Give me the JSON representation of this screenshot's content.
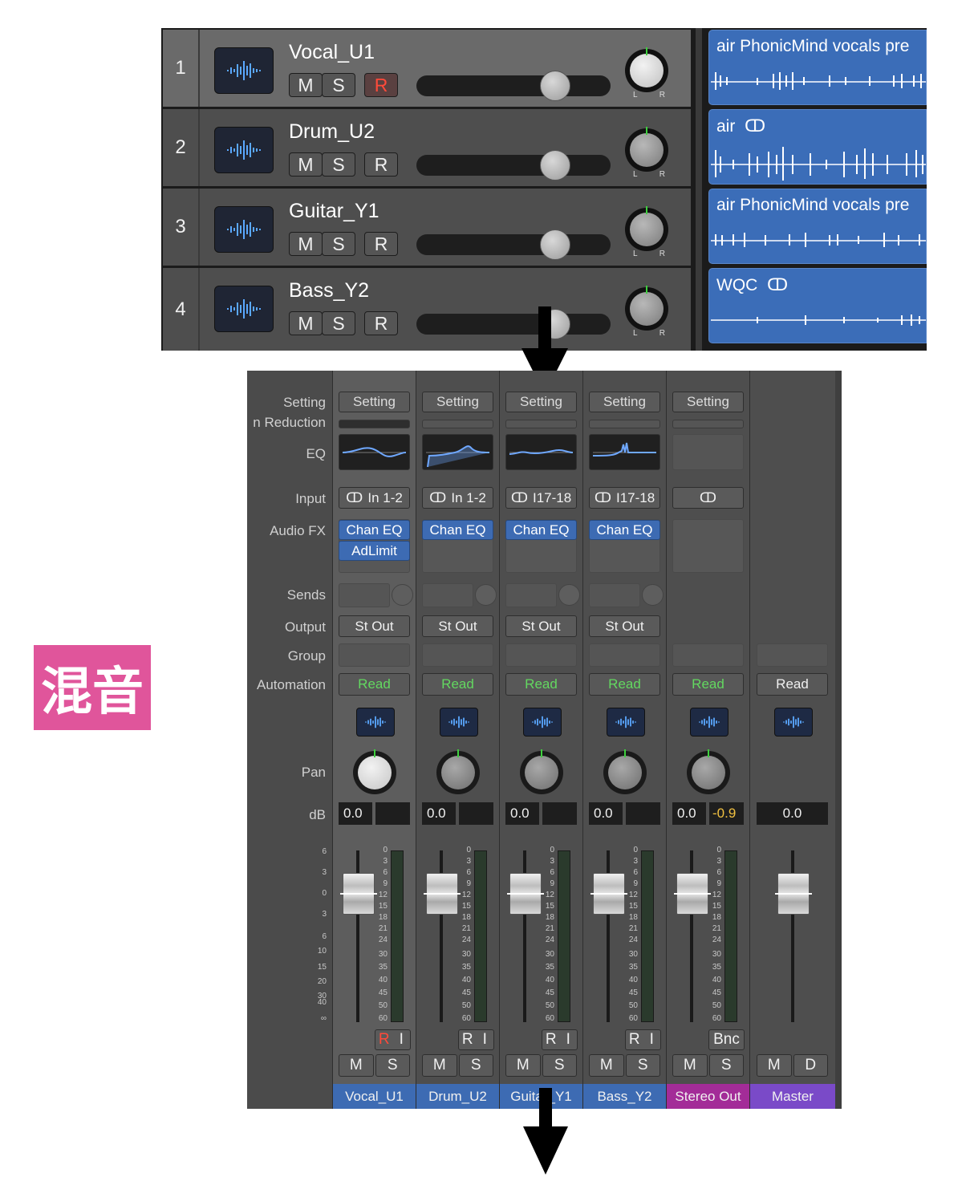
{
  "tracks": [
    {
      "number": "1",
      "name": "Vocal_U1",
      "mute": "M",
      "solo": "S",
      "record": "R",
      "record_armed": true,
      "region_name": "air PhonicMind vocals pre",
      "region_linked": false
    },
    {
      "number": "2",
      "name": "Drum_U2",
      "mute": "M",
      "solo": "S",
      "record": "R",
      "record_armed": false,
      "region_name": "air",
      "region_linked": true
    },
    {
      "number": "3",
      "name": "Guitar_Y1",
      "mute": "M",
      "solo": "S",
      "record": "R",
      "record_armed": false,
      "region_name": "air PhonicMind vocals pre",
      "region_linked": false
    },
    {
      "number": "4",
      "name": "Bass_Y2",
      "mute": "M",
      "solo": "S",
      "record": "R",
      "record_armed": false,
      "region_name": "WQC",
      "region_linked": true
    }
  ],
  "pan_labels": {
    "left": "L",
    "right": "R"
  },
  "link_glyph": "ↀ",
  "badge": "混音",
  "mixer": {
    "row_labels": {
      "setting": "Setting",
      "gain_reduction": "n Reduction",
      "eq": "EQ",
      "input": "Input",
      "audio_fx": "Audio FX",
      "sends": "Sends",
      "output": "Output",
      "group": "Group",
      "automation": "Automation",
      "pan": "Pan",
      "db": "dB"
    },
    "fader_scale": [
      "6",
      "3",
      "0",
      "3",
      "6",
      "10",
      "15",
      "20",
      "30",
      "40",
      "∞"
    ],
    "meter_scale": [
      "0",
      "3",
      "6",
      "9",
      "12",
      "15",
      "18",
      "21",
      "24",
      "30",
      "35",
      "40",
      "45",
      "50",
      "60"
    ],
    "strips": [
      {
        "name": "Vocal_U1",
        "setting": "Setting",
        "input": "In 1-2",
        "fx": [
          "Chan EQ",
          "AdLimit"
        ],
        "output": "St Out",
        "automation": "Read",
        "db": "0.0",
        "db_peak": "",
        "record": "R",
        "input_mon": "I",
        "mute": "M",
        "solo": "S"
      },
      {
        "name": "Drum_U2",
        "setting": "Setting",
        "input": "In 1-2",
        "fx": [
          "Chan EQ"
        ],
        "output": "St Out",
        "automation": "Read",
        "db": "0.0",
        "db_peak": "",
        "record": "R",
        "input_mon": "I",
        "mute": "M",
        "solo": "S"
      },
      {
        "name": "Guitar_Y1",
        "setting": "Setting",
        "input": "I17-18",
        "fx": [
          "Chan EQ"
        ],
        "output": "St Out",
        "automation": "Read",
        "db": "0.0",
        "db_peak": "",
        "record": "R",
        "input_mon": "I",
        "mute": "M",
        "solo": "S"
      },
      {
        "name": "Bass_Y2",
        "setting": "Setting",
        "input": "I17-18",
        "fx": [
          "Chan EQ"
        ],
        "output": "St Out",
        "automation": "Read",
        "db": "0.0",
        "db_peak": "",
        "record": "R",
        "input_mon": "I",
        "mute": "M",
        "solo": "S"
      },
      {
        "name": "Stereo Out",
        "setting": "Setting",
        "input": "",
        "fx": [],
        "output": "",
        "automation": "Read",
        "db": "0.0",
        "db_peak": "-0.9",
        "bounce": "Bnc",
        "mute": "M",
        "solo": "S"
      },
      {
        "name": "Master",
        "automation": "Read",
        "db": "0.0",
        "mute": "M",
        "dim": "D"
      }
    ]
  },
  "colors": {
    "region_blue": "#3b6db8",
    "strip_blue": "#3d6bb3",
    "stereo_out": "#a32c98",
    "master": "#7a4ac8",
    "automation_green": "#63d860",
    "record_red": "#ff4a3a",
    "badge_pink": "#e0559b"
  }
}
